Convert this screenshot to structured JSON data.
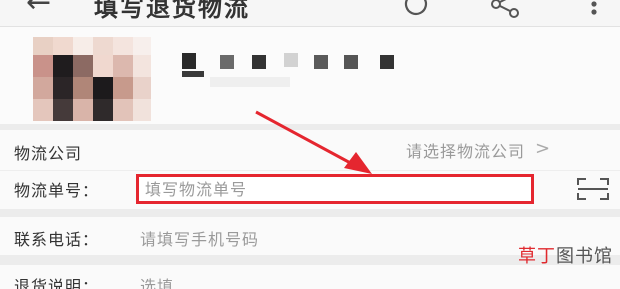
{
  "header": {
    "title": "填写退货物流",
    "back_icon": "back-arrow-icon",
    "refresh_icon": "refresh-icon",
    "share_icon": "share-icon",
    "more_icon": "more-icon"
  },
  "product": {
    "thumbnail": "product-thumbnail-pixelated",
    "title_obscured": true
  },
  "form": {
    "company": {
      "label": "物流公司",
      "value": "请选择物流公司",
      "chevron": ">"
    },
    "tracking": {
      "label": "物流单号：",
      "placeholder": "填写物流单号",
      "highlight_color": "#e5262f",
      "scan_icon": "scan-icon"
    },
    "phone": {
      "label": "联系电话：",
      "placeholder": "请填写手机号码"
    },
    "note": {
      "label": "退货说明：",
      "placeholder": "选填"
    }
  },
  "annotation": {
    "arrow_color": "#e5262f"
  },
  "watermark": {
    "accent": "草丁",
    "rest": "图书馆"
  }
}
